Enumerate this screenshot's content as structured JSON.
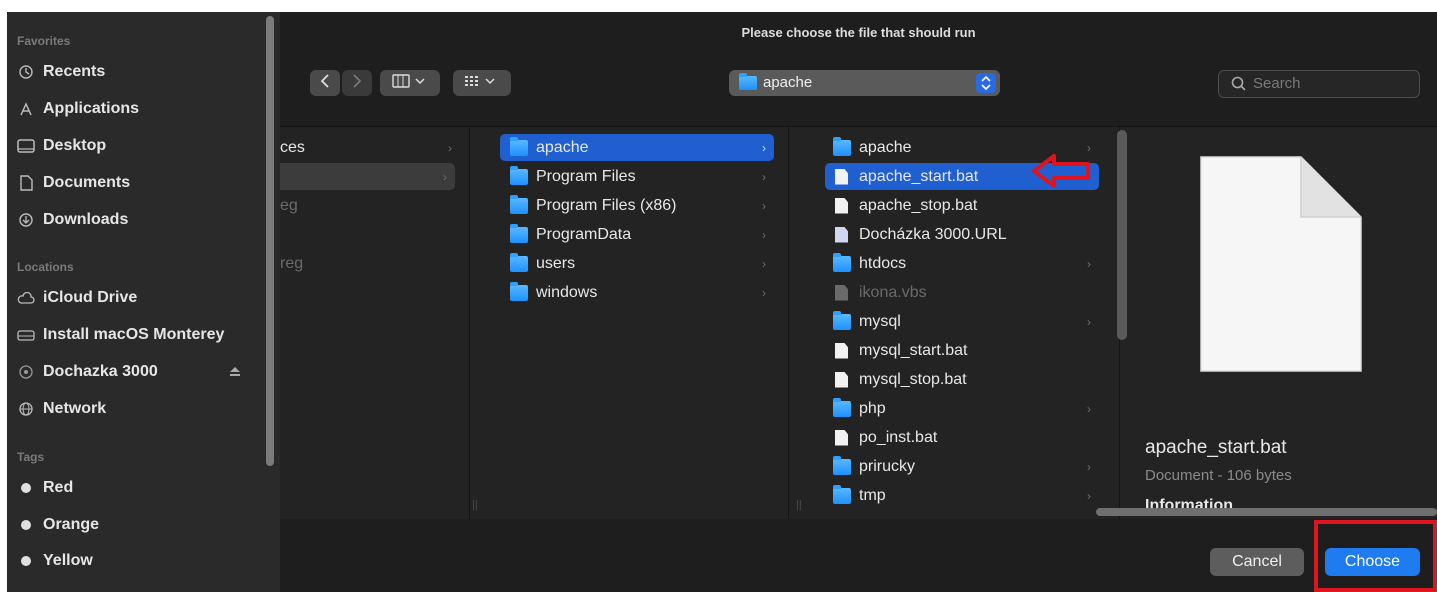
{
  "dialog": {
    "title": "Please choose the file that should run"
  },
  "sidebar": {
    "favorites_label": "Favorites",
    "favorites": [
      {
        "label": "Recents",
        "icon": "clock-icon"
      },
      {
        "label": "Applications",
        "icon": "applications-icon"
      },
      {
        "label": "Desktop",
        "icon": "desktop-icon"
      },
      {
        "label": "Documents",
        "icon": "document-icon"
      },
      {
        "label": "Downloads",
        "icon": "download-icon"
      }
    ],
    "locations_label": "Locations",
    "locations": [
      {
        "label": "iCloud Drive",
        "icon": "cloud-icon"
      },
      {
        "label": "Install macOS Monterey",
        "icon": "drive-icon"
      },
      {
        "label": "Dochazka 3000",
        "icon": "disk-icon"
      },
      {
        "label": "Network",
        "icon": "network-icon"
      }
    ],
    "tags_label": "Tags",
    "tags": [
      "Red",
      "Orange",
      "Yellow"
    ]
  },
  "toolbar": {
    "location": "apache",
    "search_placeholder": "Search"
  },
  "columns": {
    "col1": [
      "ces",
      "",
      "eg",
      "",
      "reg"
    ],
    "col2": [
      {
        "label": "apache",
        "selected": true
      },
      {
        "label": "Program Files"
      },
      {
        "label": "Program Files (x86)"
      },
      {
        "label": "ProgramData"
      },
      {
        "label": "users"
      },
      {
        "label": "windows"
      }
    ],
    "col3": [
      {
        "label": "apache",
        "type": "folder"
      },
      {
        "label": "apache_start.bat",
        "type": "doc",
        "selected": true
      },
      {
        "label": "apache_stop.bat",
        "type": "doc"
      },
      {
        "label": "Docházka 3000.URL",
        "type": "url"
      },
      {
        "label": "htdocs",
        "type": "folder"
      },
      {
        "label": "ikona.vbs",
        "type": "doc",
        "dim": true
      },
      {
        "label": "mysql",
        "type": "folder"
      },
      {
        "label": "mysql_start.bat",
        "type": "doc"
      },
      {
        "label": "mysql_stop.bat",
        "type": "doc"
      },
      {
        "label": "php",
        "type": "folder"
      },
      {
        "label": "po_inst.bat",
        "type": "doc"
      },
      {
        "label": "prirucky",
        "type": "folder"
      },
      {
        "label": "tmp",
        "type": "folder"
      }
    ]
  },
  "preview": {
    "filename": "apache_start.bat",
    "kind": "Document - 106 bytes",
    "section": "Information"
  },
  "buttons": {
    "cancel": "Cancel",
    "choose": "Choose"
  },
  "colors": {
    "accent": "#1f5fd0",
    "annotation": "#e0141f"
  }
}
